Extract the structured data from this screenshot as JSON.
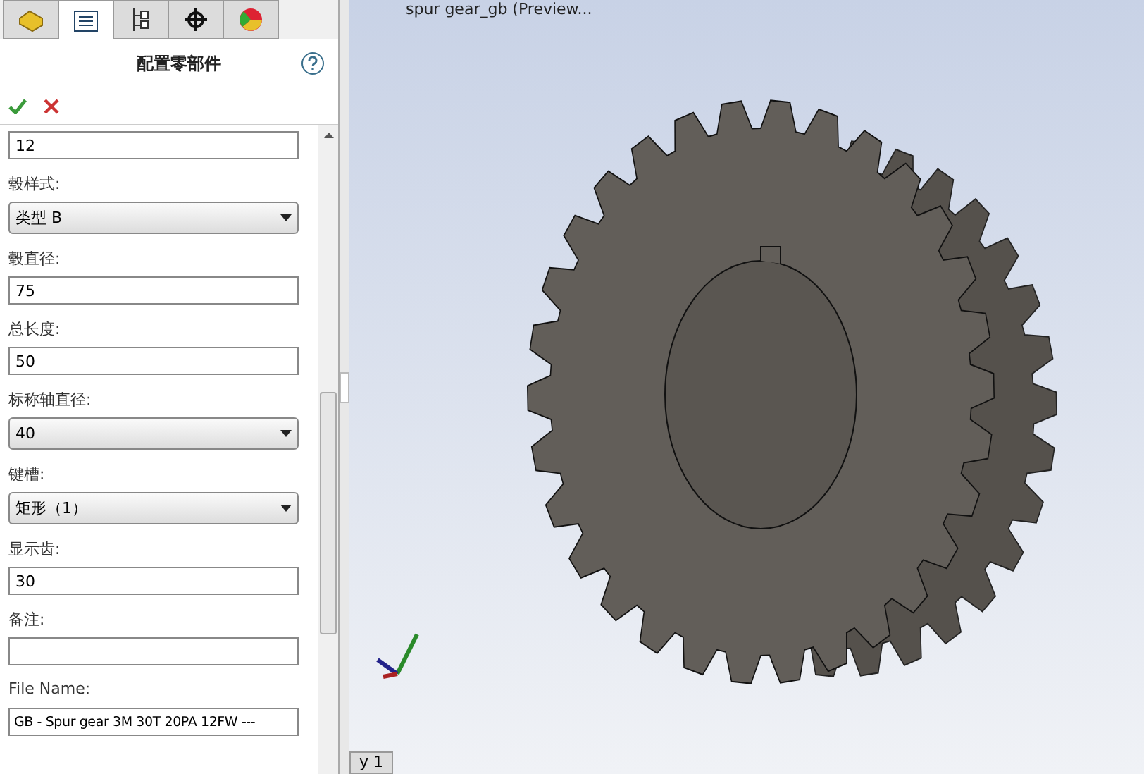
{
  "tabs": [
    {
      "selected": false
    },
    {
      "selected": true
    },
    {
      "selected": false
    },
    {
      "selected": false
    },
    {
      "selected": false
    }
  ],
  "panel": {
    "title": "配置零部件"
  },
  "fields": [
    {
      "kind": "text",
      "value": "12"
    },
    {
      "kind": "select",
      "label": "毂样式:",
      "value": "类型 B"
    },
    {
      "kind": "text",
      "label": "毂直径:",
      "value": "75"
    },
    {
      "kind": "text",
      "label": "总长度:",
      "value": "50"
    },
    {
      "kind": "select",
      "label": "标称轴直径:",
      "value": "40"
    },
    {
      "kind": "select",
      "label": "键槽:",
      "value": "矩形（1）"
    },
    {
      "kind": "text",
      "label": "显示齿:",
      "value": "30"
    },
    {
      "kind": "text",
      "label": "备注:"
    },
    {
      "kind": "combo",
      "label": "File Name:",
      "value": "GB - Spur gear 3M 30T 20PA 12FW ---"
    }
  ],
  "viewport": {
    "document_title": "spur gear_gb (Preview...",
    "bottom_tab": "y 1"
  }
}
